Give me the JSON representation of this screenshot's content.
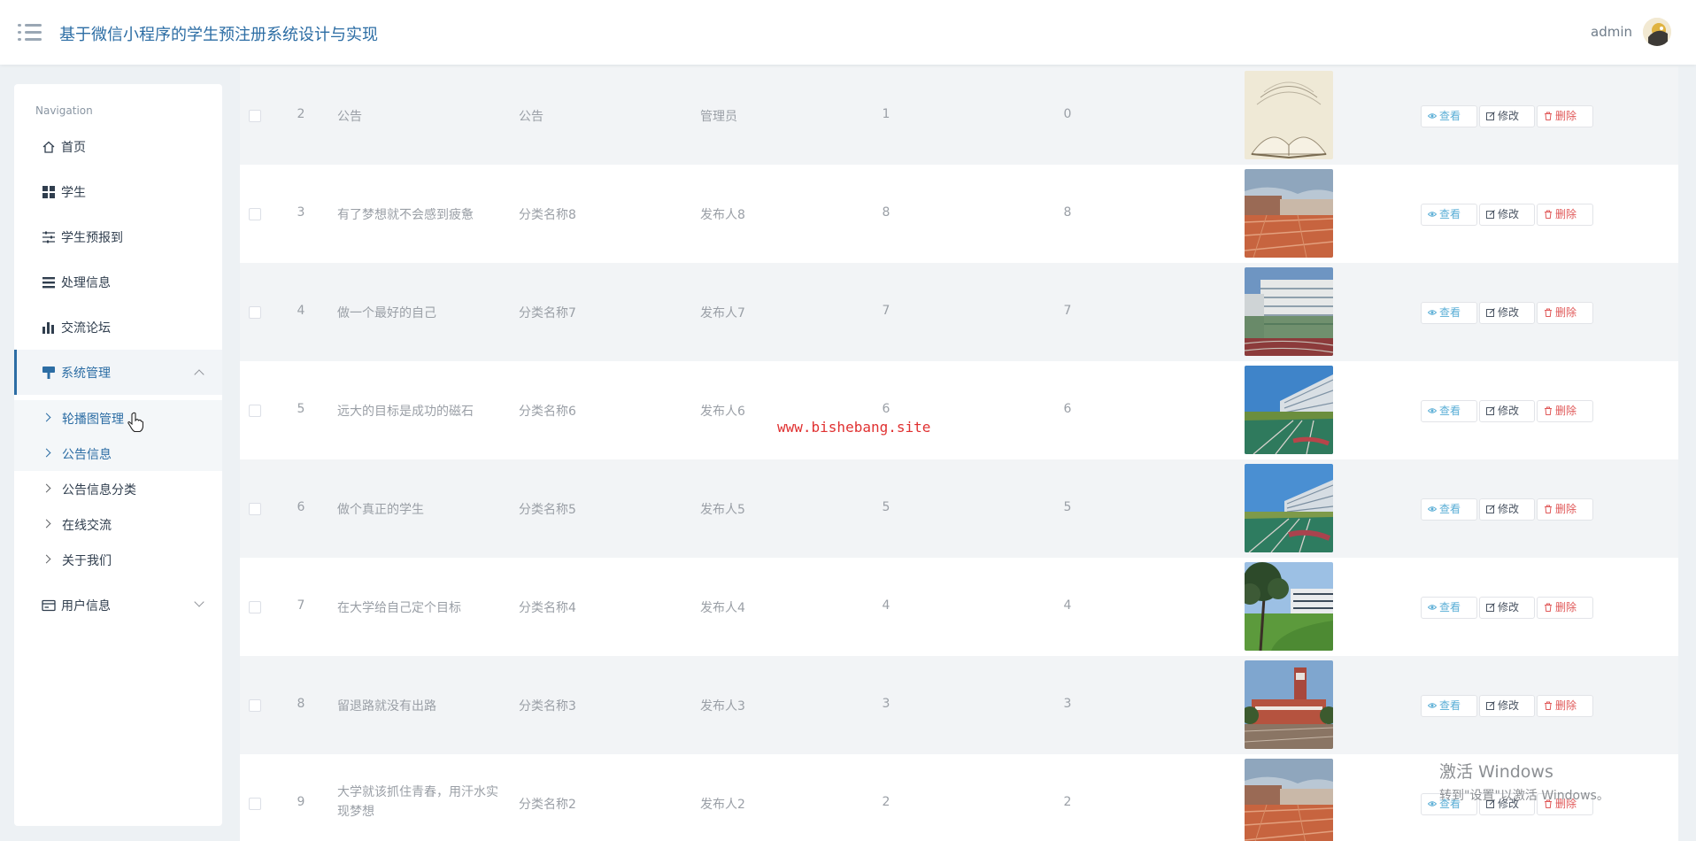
{
  "app": {
    "title": "基于微信小程序的学生预注册系统设计与实现",
    "user": "admin"
  },
  "sidebar": {
    "caption": "Navigation",
    "items": [
      {
        "label": "首页",
        "icon": "home-icon"
      },
      {
        "label": "学生",
        "icon": "grid-icon"
      },
      {
        "label": "学生预报到",
        "icon": "sliders-icon"
      },
      {
        "label": "处理信息",
        "icon": "list-icon"
      },
      {
        "label": "交流论坛",
        "icon": "bar-chart-icon"
      },
      {
        "label": "系统管理",
        "icon": "brush-icon",
        "expanded": true
      },
      {
        "label": "用户信息",
        "icon": "id-card-icon",
        "expanded": false
      }
    ],
    "sub_items": [
      "轮播图管理",
      "公告信息",
      "公告信息分类",
      "在线交流",
      "关于我们"
    ]
  },
  "buttons": {
    "view": "查看",
    "edit": "修改",
    "delete": "删除"
  },
  "rows": [
    {
      "index": "2",
      "title": "公告",
      "category": "公告",
      "publisher": "管理员",
      "n1": "1",
      "n2": "0",
      "image": "book"
    },
    {
      "index": "3",
      "title": "有了梦想就不会感到疲惫",
      "category": "分类名称8",
      "publisher": "发布人8",
      "n1": "8",
      "n2": "8",
      "image": "campus-plaza"
    },
    {
      "index": "4",
      "title": "做一个最好的自己",
      "category": "分类名称7",
      "publisher": "发布人7",
      "n1": "7",
      "n2": "7",
      "image": "campus-building"
    },
    {
      "index": "5",
      "title": "远大的目标是成功的磁石",
      "category": "分类名称6",
      "publisher": "发布人6",
      "n1": "6",
      "n2": "6",
      "image": "campus-track"
    },
    {
      "index": "6",
      "title": "做个真正的学生",
      "category": "分类名称5",
      "publisher": "发布人5",
      "n1": "5",
      "n2": "5",
      "image": "campus-track"
    },
    {
      "index": "7",
      "title": "在大学给自己定个目标",
      "category": "分类名称4",
      "publisher": "发布人4",
      "n1": "4",
      "n2": "4",
      "image": "campus-lawn"
    },
    {
      "index": "8",
      "title": "留退路就没有出路",
      "category": "分类名称3",
      "publisher": "发布人3",
      "n1": "3",
      "n2": "3",
      "image": "campus-tower"
    },
    {
      "index": "9",
      "title": "大学就该抓住青春，用汗水实现梦想",
      "category": "分类名称2",
      "publisher": "发布人2",
      "n1": "2",
      "n2": "2",
      "image": "campus-plaza"
    }
  ],
  "overlay": {
    "watermark": "www.bishebang.site",
    "windows_title": "激活 Windows",
    "windows_hint": "转到\"设置\"以激活 Windows。"
  },
  "colors": {
    "primary": "#2c6da4",
    "view": "#5aaed6",
    "delete": "#e05858",
    "watermark": "#e03131"
  }
}
